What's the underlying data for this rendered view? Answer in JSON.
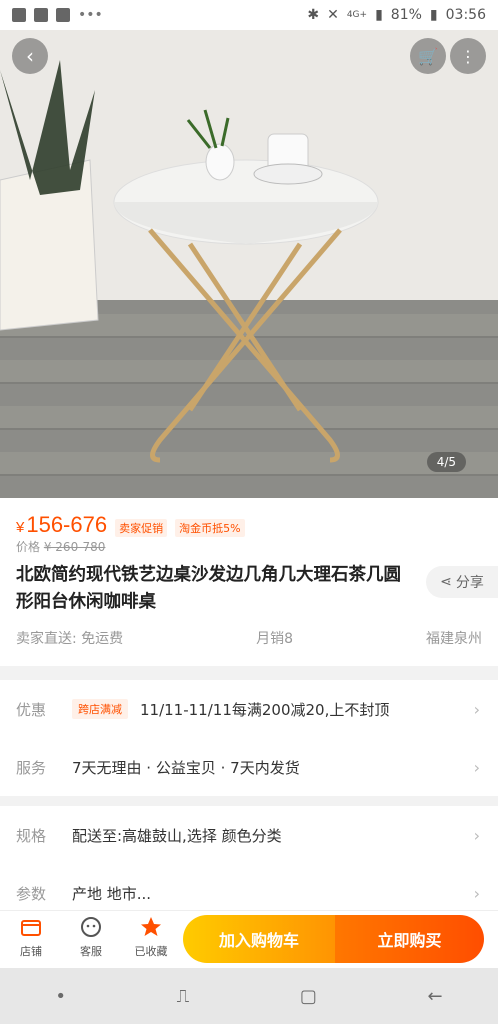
{
  "statusbar": {
    "battery": "81%",
    "time": "03:56",
    "network": "4G+"
  },
  "hero": {
    "page_indicator": "4/5",
    "image_desc_icons": [
      "back-icon",
      "cart-icon",
      "more-icon"
    ]
  },
  "product": {
    "price": "156-676",
    "yen": "¥",
    "tag1": "卖家促销",
    "tag2": "淘金币抵5%",
    "orig_label": "价格",
    "orig_price": "¥ 260-780",
    "title": "北欧简约现代铁艺边桌沙发边几角几大理石茶几圆形阳台休闲咖啡桌",
    "share": "分享",
    "shipping": "卖家直送: 免运费",
    "monthly_sales": "月销8",
    "location": "福建泉州"
  },
  "promo": {
    "label": "优惠",
    "pill": "跨店满减",
    "text": "11/11-11/11每满200减20,上不封顶"
  },
  "service": {
    "label": "服务",
    "text": "7天无理由 · 公益宝贝 · 7天内发货"
  },
  "spec": {
    "label": "规格",
    "text": "配送至:高雄鼓山,选择 颜色分类"
  },
  "params": {
    "label": "参数",
    "text": "产地 地市..."
  },
  "bottombar": {
    "shop": "店铺",
    "service": "客服",
    "fav": "已收藏",
    "cart": "加入购物车",
    "buy": "立即购买"
  },
  "colors": {
    "accent": "#ff5000",
    "cart_btn": "#ffa200",
    "buy_btn": "#ff5a00"
  }
}
